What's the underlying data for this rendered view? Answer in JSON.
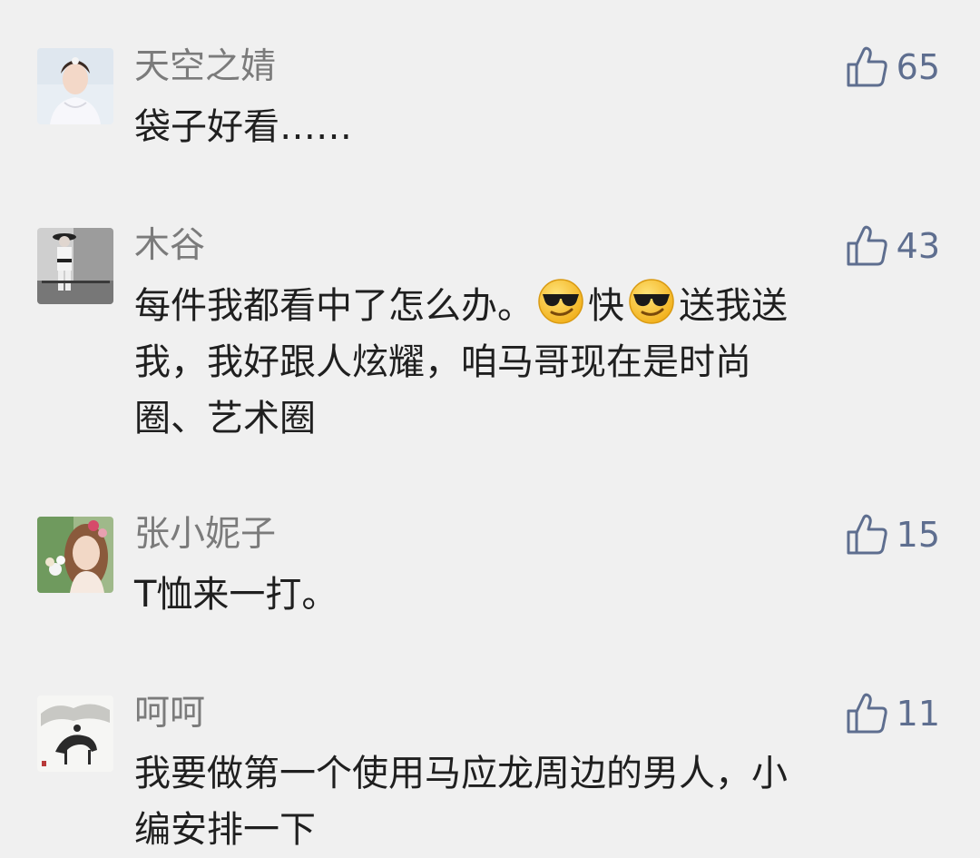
{
  "comments": [
    {
      "username": "天空之婧",
      "likes": "65",
      "avatar_icon": "avatar-woman-white-dress",
      "lines": [
        "袋子好看……"
      ]
    },
    {
      "username": "木谷",
      "likes": "43",
      "avatar_icon": "avatar-man-black-white",
      "lines": [
        "每件我都看中了怎么办。",
        "快",
        "送我送",
        "我，我好跟人炫耀，咱马哥现在是时尚",
        "圈、艺术圈"
      ]
    },
    {
      "username": "张小妮子",
      "likes": "15",
      "avatar_icon": "avatar-woman-flowers",
      "lines": [
        "T恤来一打。"
      ]
    },
    {
      "username": "呵呵",
      "likes": "11",
      "avatar_icon": "avatar-ink-horse-painting",
      "lines": [
        "我要做第一个使用马应龙周边的男人，小",
        "编安排一下"
      ]
    }
  ],
  "emoji_name": "cool-sunglasses-emoji",
  "colors": {
    "background": "#f0f0f0",
    "username": "#7b7b7b",
    "like_count": "#5e6e8f",
    "content": "#1f1f1f"
  }
}
